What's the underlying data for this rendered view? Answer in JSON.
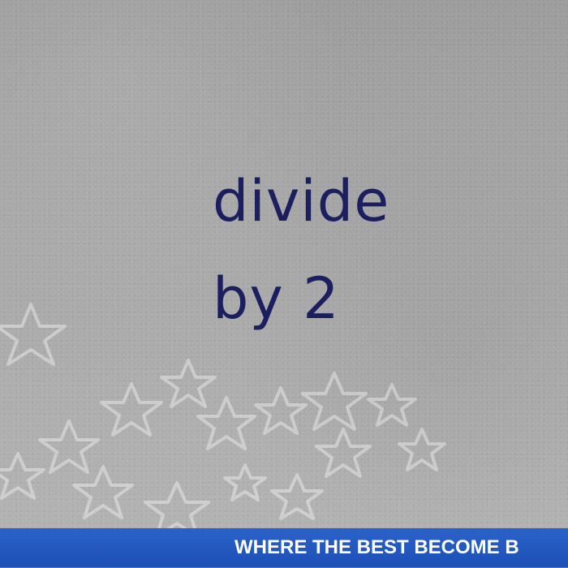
{
  "slide": {
    "line1": "divide",
    "line2": "by 2"
  },
  "footer": {
    "tagline": "WHERE THE BEST BECOME B"
  },
  "colors": {
    "text": "#1c1f5f",
    "banner": "#1d4fb5",
    "banner_text": "#ffffff"
  },
  "icons": {
    "decoration": "star-outline-icons"
  }
}
